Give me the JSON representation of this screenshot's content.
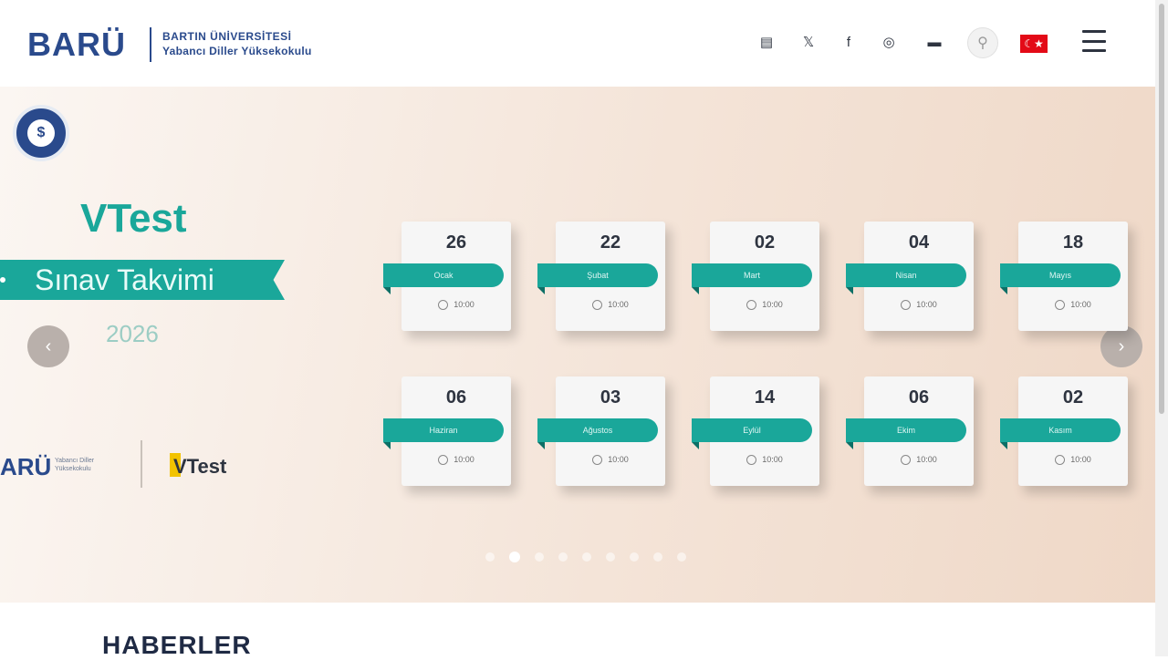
{
  "header": {
    "logo": "BARÜ",
    "logo_sub1": "BARTIN ÜNİVERSİTESİ",
    "logo_sub2": "Yabancı Diller Yüksekokulu",
    "icons": [
      "email-icon",
      "x-icon",
      "facebook-icon",
      "instagram-icon",
      "youtube-icon"
    ],
    "icon_glyphs": [
      "▤",
      "𝕏",
      "f",
      "◎",
      "▬"
    ],
    "accessibility_glyph": "⚲",
    "flag_glyph": "☾★",
    "menu": "menu-icon"
  },
  "hero": {
    "badge_glyph": "$",
    "title": "VTest",
    "ribbon": "Sınav Takvimi",
    "year": "2026",
    "prev_glyph": "‹",
    "next_glyph": "›",
    "footer_logo": "ARÜ",
    "footer_logo_sub": "Yabancı Diller Yüksekokulu",
    "footer_vtest": "VTest"
  },
  "calendar": [
    {
      "day": "26",
      "month": "Ocak",
      "time": "10:00"
    },
    {
      "day": "22",
      "month": "Şubat",
      "time": "10:00"
    },
    {
      "day": "02",
      "month": "Mart",
      "time": "10:00"
    },
    {
      "day": "04",
      "month": "Nisan",
      "time": "10:00"
    },
    {
      "day": "18",
      "month": "Mayıs",
      "time": "10:00"
    },
    {
      "day": "06",
      "month": "Haziran",
      "time": "10:00"
    },
    {
      "day": "03",
      "month": "Ağustos",
      "time": "10:00"
    },
    {
      "day": "14",
      "month": "Eylül",
      "time": "10:00"
    },
    {
      "day": "06",
      "month": "Ekim",
      "time": "10:00"
    },
    {
      "day": "02",
      "month": "Kasım",
      "time": "10:00"
    }
  ],
  "pagination": {
    "count": 9,
    "active_index": 1
  },
  "section": {
    "title": "HABERLER"
  },
  "colors": {
    "brand": "#2a4a8c",
    "teal": "#1aa79a"
  }
}
